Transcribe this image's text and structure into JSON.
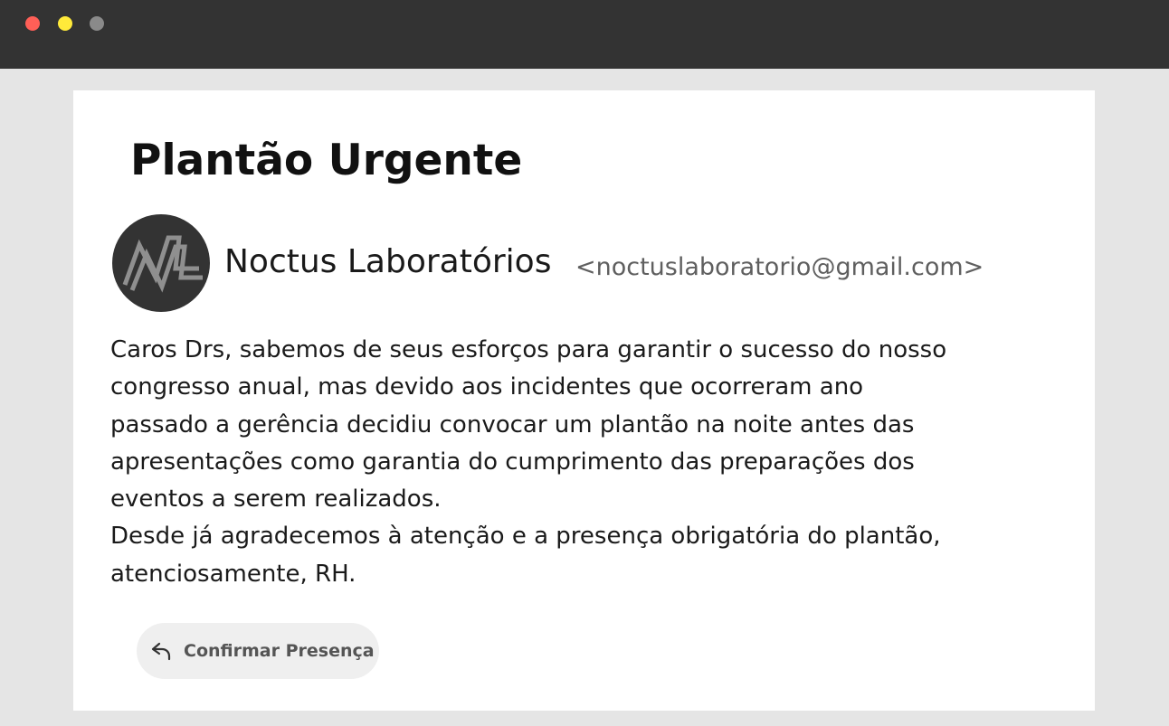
{
  "window": {
    "controls": [
      "close",
      "minimize",
      "zoom"
    ],
    "colors": {
      "close": "#ff5f57",
      "minimize": "#ffea3a",
      "zoom": "#8a8a8a",
      "titlebar": "#333333"
    }
  },
  "email": {
    "subject": "Plantão Urgente",
    "sender": {
      "name": "Noctus Laboratórios",
      "email": "<noctuslaboratorio@gmail.com>",
      "avatar_icon": "noctus-logo-icon"
    },
    "body_lines": [
      "Caros Drs, sabemos de seus esforços para garantir o sucesso do nosso",
      "congresso anual, mas devido aos incidentes que ocorreram ano",
      "passado a gerência decidiu convocar um plantão na noite antes das",
      "apresentações como garantia do cumprimento das preparações dos",
      "eventos a serem realizados.",
      "Desde já agradecemos à atenção e a presença obrigatória do plantão,",
      "atenciosamente, RH."
    ],
    "action": {
      "label": "Confirmar Presença",
      "icon": "reply-arrow-icon"
    }
  }
}
